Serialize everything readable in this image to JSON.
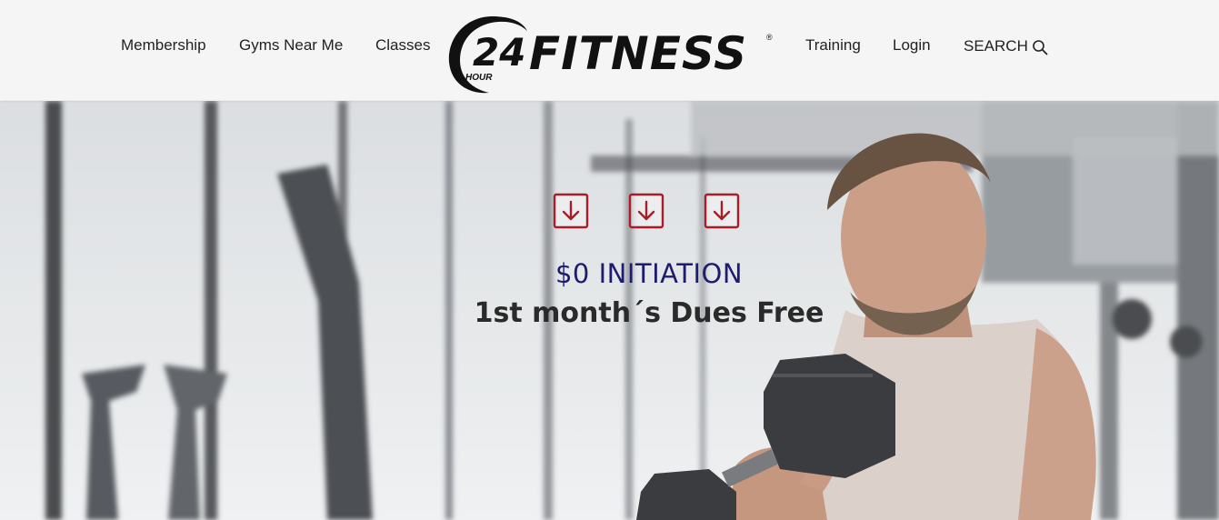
{
  "nav": {
    "left": [
      "Membership",
      "Gyms Near Me",
      "Classes"
    ],
    "right": [
      "Training",
      "Login"
    ],
    "search_label": "SEARCH"
  },
  "logo": {
    "number": "24",
    "hour": "HOUR",
    "word": "FITNESS",
    "mark": "®"
  },
  "hero": {
    "headline": "$0 INITIATION",
    "subheadline": "1st month´s Dues Free",
    "icons": [
      "arrow-down-icon",
      "arrow-down-icon",
      "arrow-down-icon"
    ]
  },
  "colors": {
    "header_bg": "#f5f5f6",
    "accent_red": "#a81d27",
    "headline_navy": "#1d1c6e"
  }
}
